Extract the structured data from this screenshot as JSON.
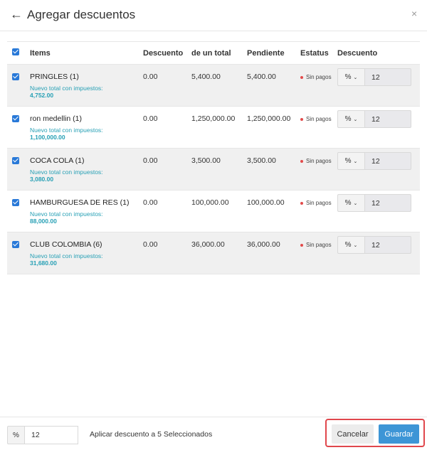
{
  "header": {
    "back_icon": "arrow-left-icon",
    "title": "Agregar descuentos",
    "close_icon": "close-icon",
    "back_glyph": "←",
    "close_glyph": "×"
  },
  "table": {
    "columns": [
      "Items",
      "Descuento",
      "de un total",
      "Pendiente",
      "Estatus",
      "Descuento"
    ],
    "new_total_label": "Nuevo total con impuestos:",
    "rows": [
      {
        "name": "PRINGLES (1)",
        "discount": "0.00",
        "total": "5,400.00",
        "pending": "5,400.00",
        "status": "Sin pagos",
        "new_total": "4,752.00",
        "unit": "%",
        "value": "12",
        "checked": true
      },
      {
        "name": "ron medellin (1)",
        "discount": "0.00",
        "total": "1,250,000.00",
        "pending": "1,250,000.00",
        "status": "Sin pagos",
        "new_total": "1,100,000.00",
        "unit": "%",
        "value": "12",
        "checked": true
      },
      {
        "name": "COCA COLA (1)",
        "discount": "0.00",
        "total": "3,500.00",
        "pending": "3,500.00",
        "status": "Sin pagos",
        "new_total": "3,080.00",
        "unit": "%",
        "value": "12",
        "checked": true
      },
      {
        "name": "HAMBURGUESA DE RES (1)",
        "discount": "0.00",
        "total": "100,000.00",
        "pending": "100,000.00",
        "status": "Sin pagos",
        "new_total": "88,000.00",
        "unit": "%",
        "value": "12",
        "checked": true
      },
      {
        "name": "CLUB COLOMBIA (6)",
        "discount": "0.00",
        "total": "36,000.00",
        "pending": "36,000.00",
        "status": "Sin pagos",
        "new_total": "31,680.00",
        "unit": "%",
        "value": "12",
        "checked": true
      }
    ]
  },
  "footer": {
    "unit": "%",
    "value": "12",
    "apply_label": "Aplicar descuento a 5 Seleccionados",
    "cancel_label": "Cancelar",
    "save_label": "Guardar"
  },
  "colors": {
    "accent": "#3d95d6",
    "checkbox": "#2979d8",
    "new_total": "#27a0b5",
    "status_dot": "#e24b4b",
    "highlight": "#e0474c"
  }
}
